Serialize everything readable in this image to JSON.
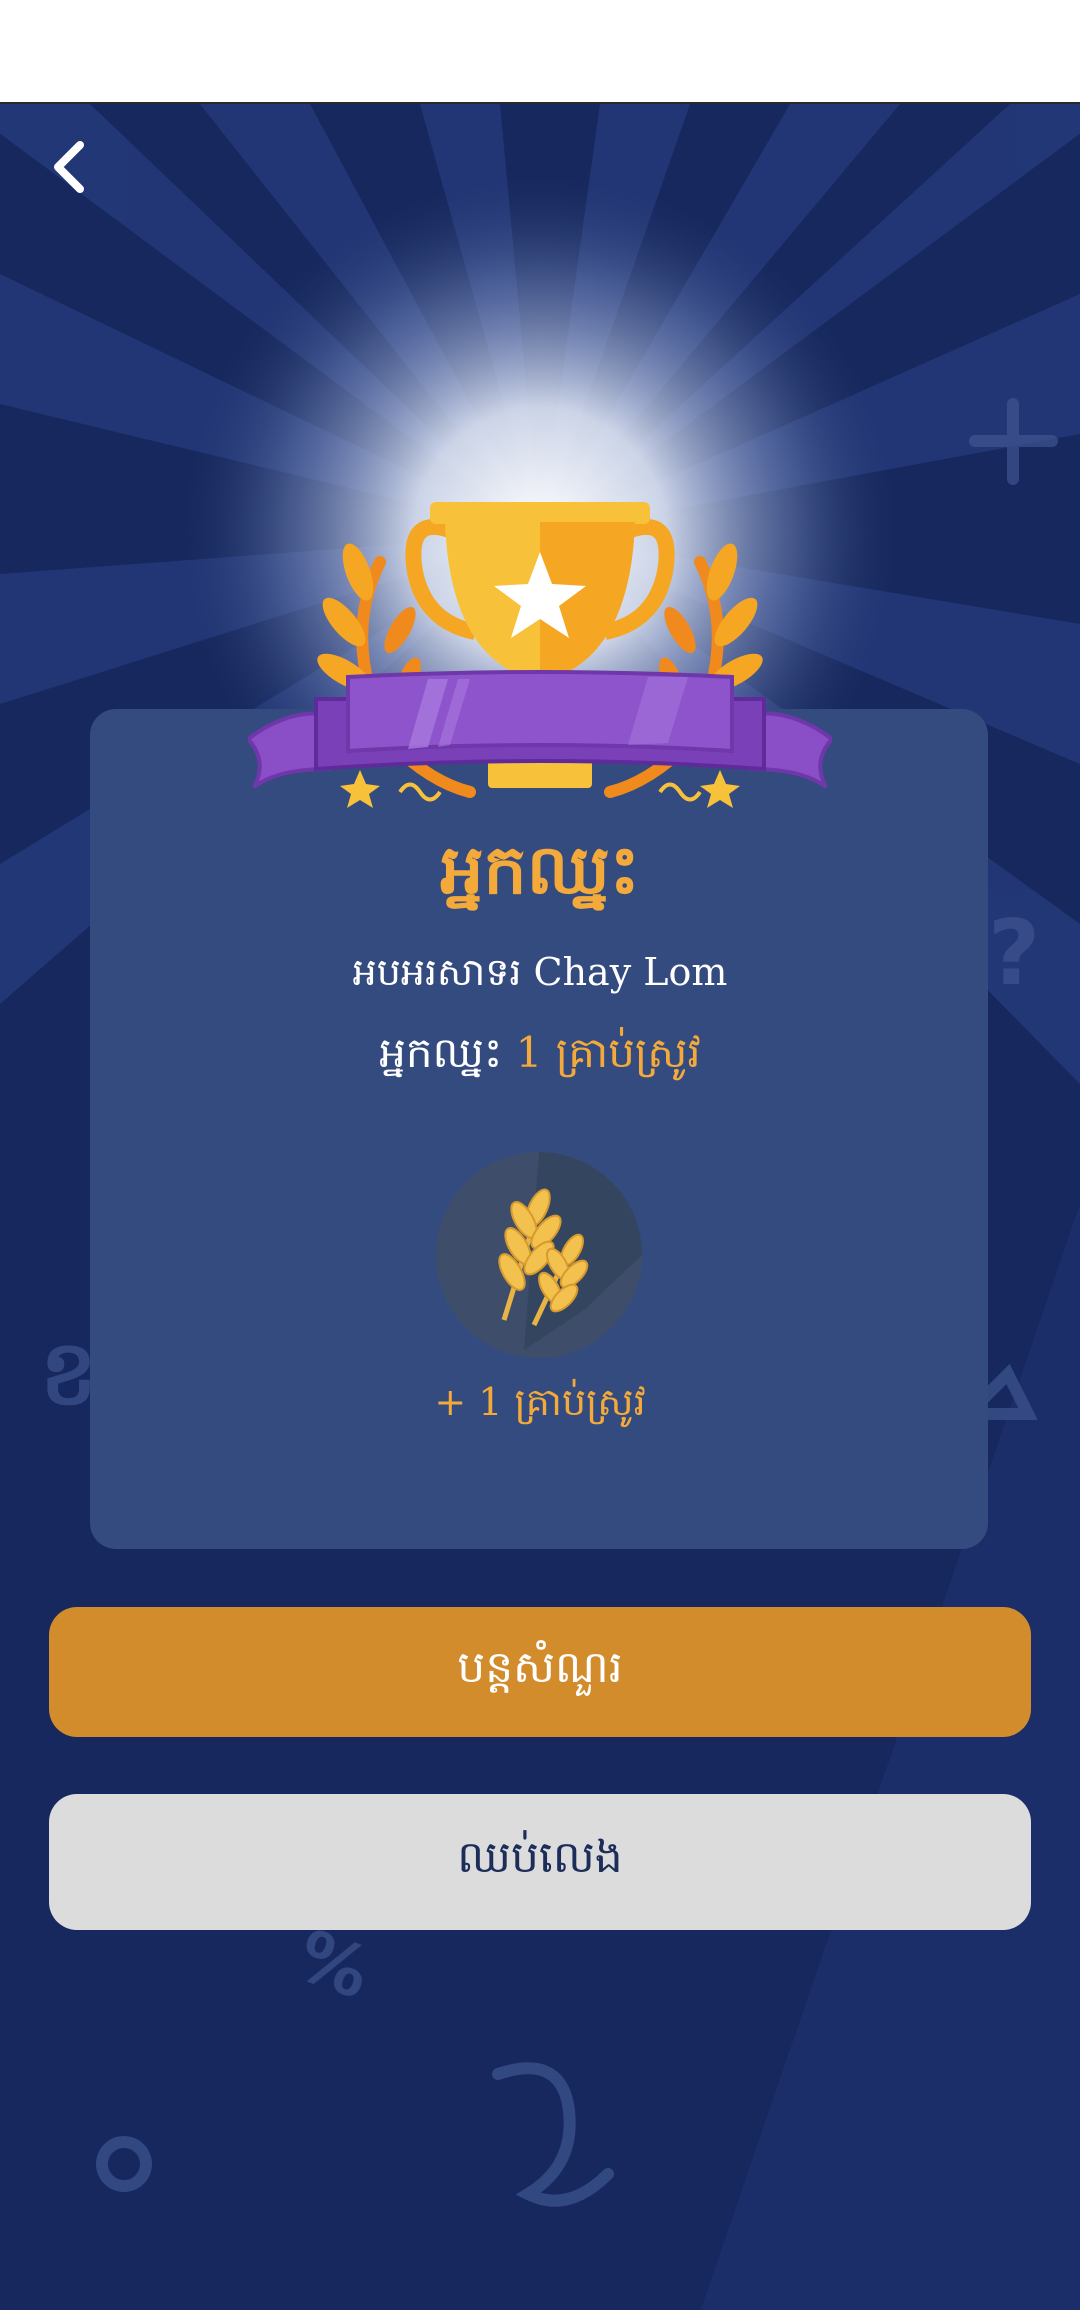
{
  "header": {
    "back_icon": "chevron-left-icon"
  },
  "result": {
    "title": "អ្នកឈ្នះ",
    "answer_text": "អបអរសាទរ Chay Lom",
    "reward_prefix": "អ្នកឈ្នះ",
    "reward_amount": "1 គ្រាប់ស្រូវ",
    "bonus_text": "+ 1 គ្រាប់ស្រូវ",
    "badge_icon": "rice-grain-icon",
    "trophy_icon": "trophy-icon"
  },
  "actions": {
    "continue_label": "បន្តសំណួរ",
    "stop_label": "ឈប់លេង"
  },
  "colors": {
    "background": "#16285e",
    "card": "#344b7f",
    "accent": "#f4a93b",
    "continue_button": "#d28c2c",
    "stop_button": "#dcdcdc",
    "ribbon": "#8a4fc6"
  }
}
